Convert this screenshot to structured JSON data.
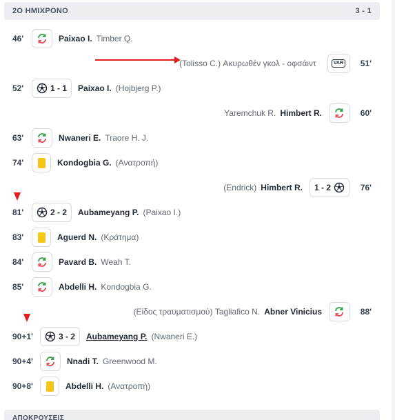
{
  "header": {
    "title": "2Ο ΗΜΙΧΡΟΝΟ",
    "score": "3 - 1"
  },
  "events": [
    {
      "minute": "46'",
      "side": "home",
      "type": "substitution",
      "player": "Paixao I.",
      "detail": "Timber Q."
    },
    {
      "minute": "51'",
      "side": "away",
      "type": "var",
      "player": "",
      "detail": "(Tolisso C.) Ακυρωθέν γκολ - οφσάιντ",
      "badge_text": "VAR"
    },
    {
      "minute": "52'",
      "side": "home",
      "type": "goal",
      "score": "1 - 1",
      "player": "Paixao I.",
      "detail": "(Hojbjerg P.)"
    },
    {
      "minute": "60'",
      "side": "away",
      "type": "substitution",
      "player": "Himbert R.",
      "detail": "Yaremchuk R."
    },
    {
      "minute": "63'",
      "side": "home",
      "type": "substitution",
      "player": "Nwaneri E.",
      "detail": "Traore H. J."
    },
    {
      "minute": "74'",
      "side": "home",
      "type": "yellow",
      "player": "Kondogbia G.",
      "detail": "(Ανατροπή)"
    },
    {
      "minute": "76'",
      "side": "away",
      "type": "goal",
      "score": "1 - 2",
      "player": "Himbert R.",
      "detail": "(Endrick)"
    },
    {
      "minute": "81'",
      "side": "home",
      "type": "goal",
      "score": "2 - 2",
      "player": "Aubameyang P.",
      "detail": "(Paixao I.)"
    },
    {
      "minute": "83'",
      "side": "home",
      "type": "yellow",
      "player": "Aguerd N.",
      "detail": "(Κράτημα)"
    },
    {
      "minute": "84'",
      "side": "home",
      "type": "substitution",
      "player": "Pavard B.",
      "detail": "Weah T."
    },
    {
      "minute": "85'",
      "side": "home",
      "type": "substitution",
      "player": "Abdelli H.",
      "detail": "Kondogbia G."
    },
    {
      "minute": "88'",
      "side": "away",
      "type": "substitution",
      "player": "Abner Vinicius",
      "detail": "(Είδος τραυματισμού) Tagliafico N."
    },
    {
      "minute": "90+1'",
      "side": "home",
      "type": "goal",
      "score": "3 - 2",
      "player": "Aubameyang P.",
      "detail": "(Nwaneri E.)",
      "underline": true
    },
    {
      "minute": "90+4'",
      "side": "home",
      "type": "substitution",
      "player": "Nnadi T.",
      "detail": "Greenwood M."
    },
    {
      "minute": "90+8'",
      "side": "home",
      "type": "yellow",
      "player": "Abdelli H.",
      "detail": "(Ανατροπή)"
    }
  ],
  "footer": {
    "title": "ΑΠΟΚΡΟΥΣΕΙΣ"
  },
  "colors": {
    "sub_green": "#2ea043",
    "sub_red": "#e5484d",
    "yellow_card": "#f5c518",
    "annotation_red": "#e31b1b",
    "header_bg": "#eceef2"
  }
}
